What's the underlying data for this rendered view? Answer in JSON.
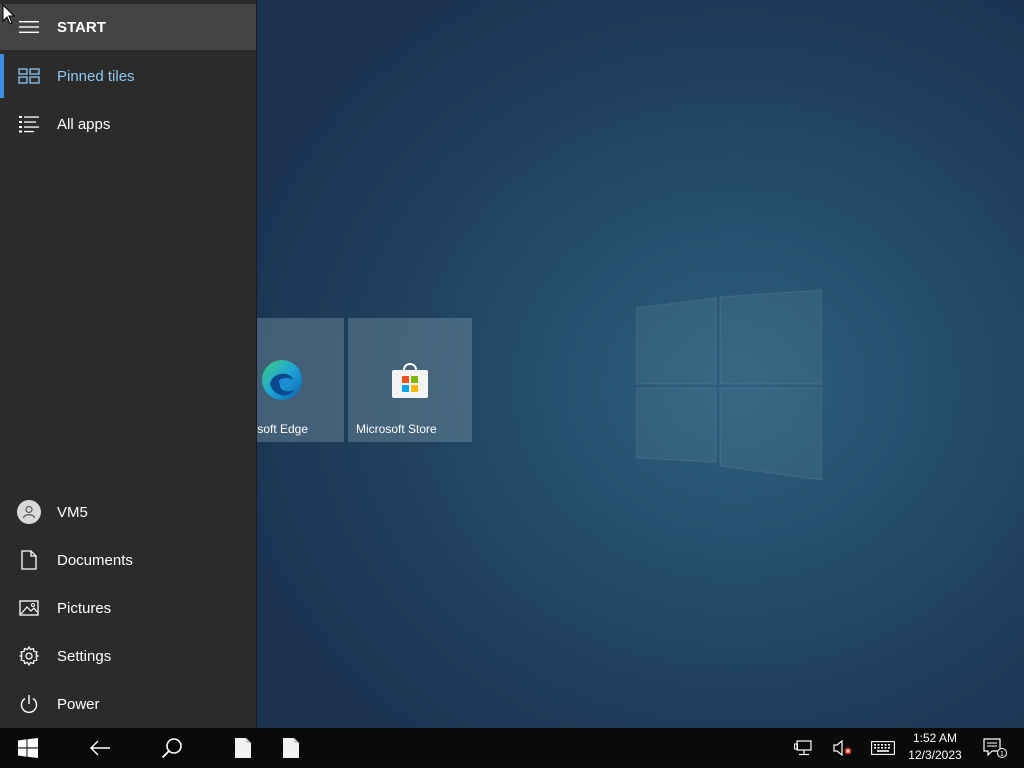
{
  "start_menu": {
    "header": "START",
    "nav": [
      {
        "label": "Pinned tiles",
        "icon": "tiles-icon",
        "selected": true
      },
      {
        "label": "All apps",
        "icon": "list-icon"
      }
    ],
    "bottom": [
      {
        "label": "VM5",
        "icon": "user-icon"
      },
      {
        "label": "Documents",
        "icon": "document-icon"
      },
      {
        "label": "Pictures",
        "icon": "pictures-icon"
      },
      {
        "label": "Settings",
        "icon": "gear-icon"
      },
      {
        "label": "Power",
        "icon": "power-icon"
      }
    ],
    "accent_color": "#3a8ee6"
  },
  "tiles": [
    {
      "label": "Microsoft Edge",
      "icon": "edge-icon"
    },
    {
      "label": "Microsoft Store",
      "icon": "store-icon"
    }
  ],
  "taskbar": {
    "buttons": [
      "windows-icon",
      "back-icon",
      "search-icon",
      "file-icon",
      "file-icon"
    ],
    "tray": [
      "network-icon",
      "volume-muted-icon",
      "keyboard-icon",
      "notifications-icon"
    ],
    "time": "1:52 AM",
    "date": "12/3/2023",
    "notification_count": "1"
  }
}
